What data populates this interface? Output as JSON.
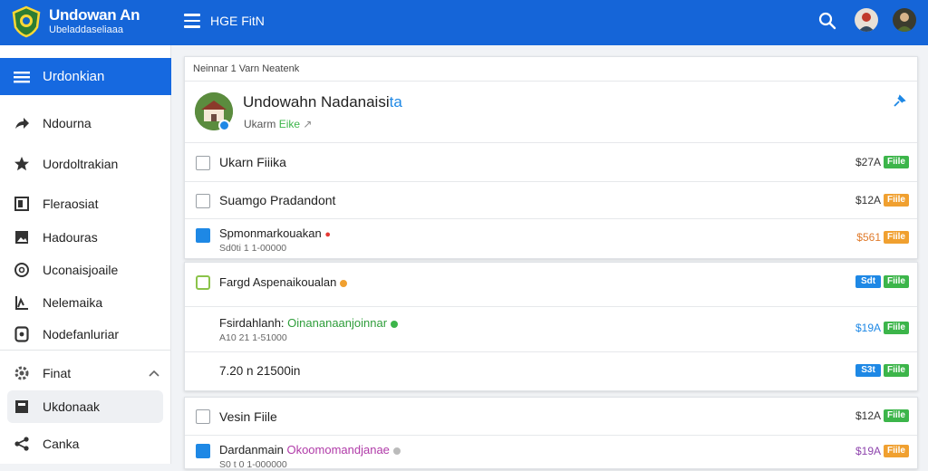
{
  "app": {
    "title": "Undowan An",
    "subtitle": "Ubeladdaseliaaa",
    "top_title": "HGE FitN"
  },
  "sidebar": {
    "active_label": "Urdonkian",
    "items": [
      {
        "label": "Ndourna",
        "icon": "share-icon"
      },
      {
        "label": "Uordoltrakian",
        "icon": "star-icon"
      },
      {
        "label": "Fleraosiat",
        "icon": "image-icon"
      },
      {
        "label": "Hadouras",
        "icon": "photo-icon"
      },
      {
        "label": "Uconaisjoaile",
        "icon": "clock-icon"
      },
      {
        "label": "Nelemaika",
        "icon": "chart-icon"
      },
      {
        "label": "Nodefanluriar",
        "icon": "doc-icon"
      }
    ],
    "section_label": "Finat",
    "selected_label": "Ukdonaak",
    "last_label": "Canka"
  },
  "card1": {
    "breadcrumb": "Neinnar 1 Varn Neatenk",
    "header_title": "Undowahn Nadanaisi",
    "header_title_accent": "ta",
    "header_sub": "Ukarm",
    "header_sub_accent": "Eike",
    "rows": [
      {
        "title": "Ukarn Fiiika",
        "price": "$27A",
        "tag": "Fiile",
        "tag_color": "#3cb54a",
        "price_color": "#333",
        "checked": false
      },
      {
        "title": "Suamgo Pradandont",
        "price": "$12A",
        "tag": "Fiile",
        "tag_color": "#f0a030",
        "price_color": "#333",
        "checked": false
      },
      {
        "title": "Spmonmarkouakan",
        "sub": "Sd0ti 1 1-00000",
        "price": "$561",
        "tag": "Fiile",
        "tag_color": "#f0a030",
        "price_color": "#e07b2c",
        "checked": true
      }
    ]
  },
  "card2": {
    "rows": [
      {
        "title": "Fargd Aspenaikoualan",
        "price": "Sdt",
        "tag": "Fiile",
        "price_tag_color": "#1e88e5",
        "tag_color": "#3cb54a"
      },
      {
        "title": "Fsirdahlanh:",
        "accent": "Oinananaanjoinnar",
        "sub": "A10 21 1-51000",
        "price": "$19A",
        "tag": "Fiile",
        "price_color": "#1e88e5",
        "tag_color": "#3cb54a"
      },
      {
        "title": "7.20 n 21500in",
        "price": "S3t",
        "tag": "Fiile",
        "price_tag_color": "#1e88e5",
        "tag_color": "#3cb54a"
      }
    ]
  },
  "card3": {
    "rows": [
      {
        "title": "Vesin Fiile",
        "price": "$12A",
        "tag": "Fiile",
        "tag_color": "#3cb54a",
        "price_color": "#333",
        "checked": false
      },
      {
        "title": "Dardanmain",
        "accent": "Okoomomandjanae",
        "sub": "S0 t 0 1-000000",
        "price": "$19A",
        "tag": "Fiile",
        "tag_color": "#f0a030",
        "price_color": "#8e44ad",
        "checked": true
      }
    ]
  },
  "colors": {
    "primary": "#1565d8",
    "active": "#1669e0",
    "green": "#3cb54a",
    "orange": "#f0a030",
    "accent_green": "#2e9d3a",
    "accent_purple": "#b03aa8"
  }
}
